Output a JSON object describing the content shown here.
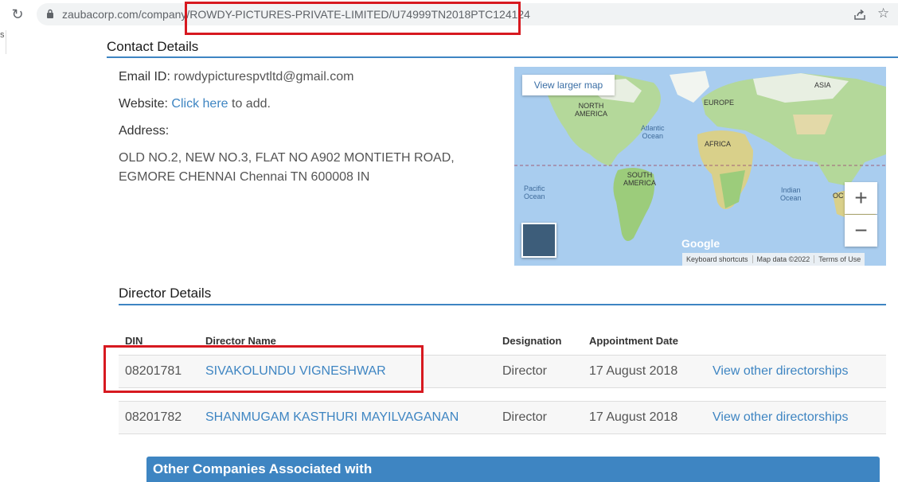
{
  "browser": {
    "url_host": "zaubacorp.com/compan",
    "url_y": "y",
    "url_path": "/ROWDY-PICTURES-PRIVATE-LIMITED/U74999TN2018PTC124124"
  },
  "side_mark": "s",
  "contact": {
    "title": "Contact Details",
    "email_label": "Email ID:",
    "email_value": "rowdypicturespvtltd@gmail.com",
    "website_label": "Website:",
    "website_link": "Click here",
    "website_suffix": "to add.",
    "address_label": "Address:",
    "address_line1": "OLD NO.2, NEW NO.3, FLAT NO A902 MONTIETH ROAD,",
    "address_line2": "EGMORE CHENNAI Chennai TN 600008 IN"
  },
  "map": {
    "larger_map": "View larger map",
    "zoom_in": "+",
    "zoom_out": "−",
    "logo": "Google",
    "attrib": [
      "Keyboard shortcuts",
      "Map data ©2022",
      "Terms of Use"
    ],
    "labels": {
      "asia": "ASIA",
      "europe": "EUROPE",
      "north_america_1": "NORTH",
      "north_america_2": "AMERICA",
      "atlantic_1": "Atlantic",
      "atlantic_2": "Ocean",
      "africa": "AFRICA",
      "south_america_1": "SOUTH",
      "south_america_2": "AMERICA",
      "pacific_1": "Pacific",
      "pacific_2": "Ocean",
      "indian_1": "Indian",
      "indian_2": "Ocean",
      "oc": "OC"
    }
  },
  "directors": {
    "title": "Director Details",
    "headers": {
      "din": "DIN",
      "name": "Director Name",
      "designation": "Designation",
      "appointment": "Appointment Date"
    },
    "rows": [
      {
        "din": "08201781",
        "name": "SIVAKOLUNDU VIGNESHWAR",
        "designation": "Director",
        "date": "17 August 2018",
        "link": "View other directorships"
      },
      {
        "din": "08201782",
        "name": "SHANMUGAM KASTHURI MAYILVAGANAN",
        "designation": "Director",
        "date": "17 August 2018",
        "link": "View other directorships"
      }
    ]
  },
  "other": {
    "title": "Other Companies Associated with"
  },
  "colors": {
    "accent": "#3e85c2",
    "highlight": "#d71920"
  }
}
